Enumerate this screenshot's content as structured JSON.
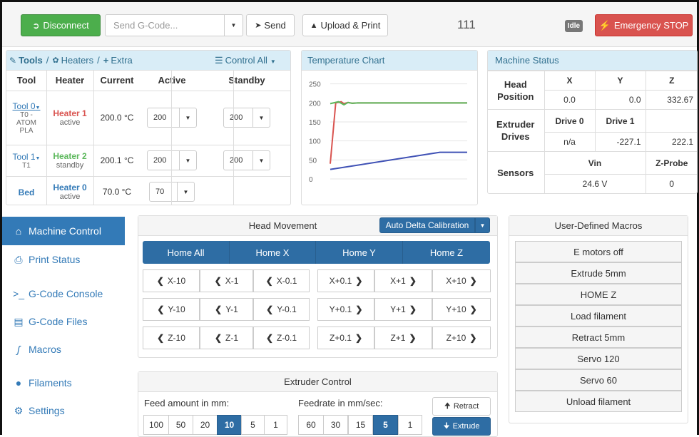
{
  "topbar": {
    "disconnect_label": "Disconnect",
    "gcode_placeholder": "Send G-Code...",
    "send_label": "Send",
    "upload_label": "Upload & Print",
    "counter": "111",
    "status_badge": "Idle",
    "estop_label": "Emergency STOP"
  },
  "tools_panel": {
    "tab_tools": "Tools",
    "sep": "/",
    "tab_heaters": "Heaters",
    "tab_extra": "Extra",
    "control_all": "Control All",
    "headers": [
      "Tool",
      "Heater",
      "Current",
      "Active",
      "Standby"
    ],
    "rows": [
      {
        "tool": "Tool 0",
        "tool_sub1": "T0 -",
        "tool_sub2": "ATOM",
        "tool_sub3": "PLA",
        "heater": "Heater 1",
        "heater_state": "active",
        "current": "200.0 °C",
        "active": "200",
        "standby": "200"
      },
      {
        "tool": "Tool 1",
        "tool_sub1": "T1",
        "heater": "Heater 2",
        "heater_state": "standby",
        "current": "200.1 °C",
        "active": "200",
        "standby": "200"
      },
      {
        "tool": "Bed",
        "heater": "Heater 0",
        "heater_state": "active",
        "current": "70.0 °C",
        "active": "70"
      }
    ]
  },
  "temp_chart": {
    "title": "Temperature Chart"
  },
  "chart_data": {
    "type": "line",
    "yticks": [
      250,
      200,
      150,
      100,
      50,
      0
    ],
    "ylim": [
      0,
      270
    ],
    "series": [
      {
        "color": "#d9534f",
        "x": [
          0,
          4,
          8,
          10,
          13,
          16,
          20,
          100
        ],
        "values": [
          40,
          200,
          203,
          198,
          201,
          199,
          200,
          200
        ]
      },
      {
        "color": "#5cb85c",
        "x": [
          0,
          6,
          10,
          13,
          16,
          20,
          100
        ],
        "values": [
          198,
          203,
          195,
          201,
          199,
          200,
          200
        ]
      },
      {
        "color": "#3f51b5",
        "x": [
          0,
          80,
          100
        ],
        "values": [
          25,
          70,
          70
        ]
      }
    ]
  },
  "machine_status": {
    "title": "Machine Status",
    "head_label": "Head",
    "position_label": "Position",
    "xyz_headers": [
      "X",
      "Y",
      "Z"
    ],
    "xyz_values": [
      "0.0",
      "0.0",
      "332.67"
    ],
    "extruder_label": "Extruder",
    "drives_label": "Drives",
    "drive_headers": [
      "Drive 0",
      "Drive 1"
    ],
    "drive_values": [
      "n/a",
      "-227.1",
      "222.1"
    ],
    "sensors_label": "Sensors",
    "sensor_headers": [
      "Vin",
      "Z-Probe"
    ],
    "sensor_values": [
      "24.6 V",
      "0"
    ]
  },
  "sidebar": {
    "items": [
      {
        "label": "Machine Control",
        "icon": "home-icon"
      },
      {
        "label": "Print Status",
        "icon": "printer-icon"
      },
      {
        "label": "G-Code Console",
        "icon": "terminal-icon"
      },
      {
        "label": "G-Code Files",
        "icon": "hdd-icon"
      },
      {
        "label": "Macros",
        "icon": "script-icon"
      },
      {
        "label": "Filaments",
        "icon": "globe-icon"
      },
      {
        "label": "Settings",
        "icon": "gear-icon"
      }
    ]
  },
  "head_movement": {
    "title": "Head Movement",
    "auto_delta": "Auto Delta Calibration",
    "home_buttons": [
      "Home All",
      "Home X",
      "Home Y",
      "Home Z"
    ],
    "rows": [
      [
        "X-10",
        "X-1",
        "X-0.1",
        "X+0.1",
        "X+1",
        "X+10"
      ],
      [
        "Y-10",
        "Y-1",
        "Y-0.1",
        "Y+0.1",
        "Y+1",
        "Y+10"
      ],
      [
        "Z-10",
        "Z-1",
        "Z-0.1",
        "Z+0.1",
        "Z+1",
        "Z+10"
      ]
    ]
  },
  "extruder": {
    "title": "Extruder Control",
    "feed_label": "Feed amount in mm:",
    "feedrate_label": "Feedrate in mm/sec:",
    "feed_amounts": [
      "100",
      "50",
      "20",
      "10",
      "5",
      "1"
    ],
    "feed_selected": "10",
    "feedrates": [
      "60",
      "30",
      "15",
      "5",
      "1"
    ],
    "feedrate_selected": "5",
    "retract_label": "Retract",
    "extrude_label": "Extrude"
  },
  "macros": {
    "title": "User-Defined Macros",
    "items": [
      "E motors off",
      "Extrude 5mm",
      "HOME Z",
      "Load filament",
      "Retract 5mm",
      "Servo 120",
      "Servo 60",
      "Unload filament"
    ]
  }
}
